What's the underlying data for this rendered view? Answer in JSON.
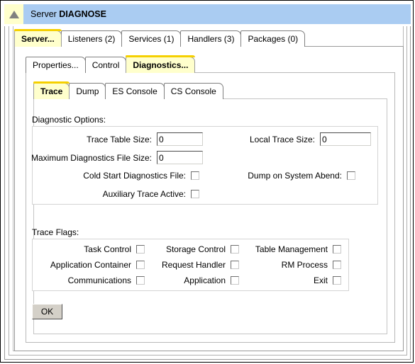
{
  "window": {
    "title_prefix": "Server ",
    "title_name": "DIAGNOSE",
    "icon": "up-triangle-icon"
  },
  "tabs_level1": [
    {
      "label": "Server...",
      "selected": true
    },
    {
      "label": "Listeners (2)",
      "selected": false
    },
    {
      "label": "Services (1)",
      "selected": false
    },
    {
      "label": "Handlers (3)",
      "selected": false
    },
    {
      "label": "Packages (0)",
      "selected": false
    }
  ],
  "tabs_level2": [
    {
      "label": "Properties...",
      "selected": false
    },
    {
      "label": "Control",
      "selected": false
    },
    {
      "label": "Diagnostics...",
      "selected": true
    }
  ],
  "tabs_level3": [
    {
      "label": "Trace",
      "selected": true
    },
    {
      "label": "Dump",
      "selected": false
    },
    {
      "label": "ES Console",
      "selected": false
    },
    {
      "label": "CS Console",
      "selected": false
    }
  ],
  "diagnostic_options": {
    "group_label": "Diagnostic Options:",
    "trace_table_size": {
      "label": "Trace Table Size:",
      "value": "0"
    },
    "local_trace_size": {
      "label": "Local Trace Size:",
      "value": "0"
    },
    "maximum_diagnostics_file_size": {
      "label": "Maximum Diagnostics File Size:",
      "value": "0"
    },
    "cold_start_diagnostics_file": {
      "label": "Cold Start Diagnostics File:",
      "checked": false
    },
    "dump_on_system_abend": {
      "label": "Dump on System Abend:",
      "checked": false
    },
    "auxiliary_trace_active": {
      "label": "Auxiliary Trace Active:",
      "checked": false
    }
  },
  "trace_flags": {
    "group_label": "Trace Flags:",
    "items": [
      {
        "label": "Task Control",
        "checked": false
      },
      {
        "label": "Storage Control",
        "checked": false
      },
      {
        "label": "Table Management",
        "checked": false
      },
      {
        "label": "Application Container",
        "checked": false
      },
      {
        "label": "Request Handler",
        "checked": false
      },
      {
        "label": "RM Process",
        "checked": false
      },
      {
        "label": "Communications",
        "checked": false
      },
      {
        "label": "Application",
        "checked": false
      },
      {
        "label": "Exit",
        "checked": false
      }
    ]
  },
  "actions": {
    "ok_label": "OK"
  },
  "colors": {
    "titlebar": "#aaccf2",
    "tab_selected_bg": "#ffffcc",
    "tab_selected_accent": "#f5d000",
    "icon_bg": "#ffffcc",
    "button_face": "#d4d0c8"
  }
}
